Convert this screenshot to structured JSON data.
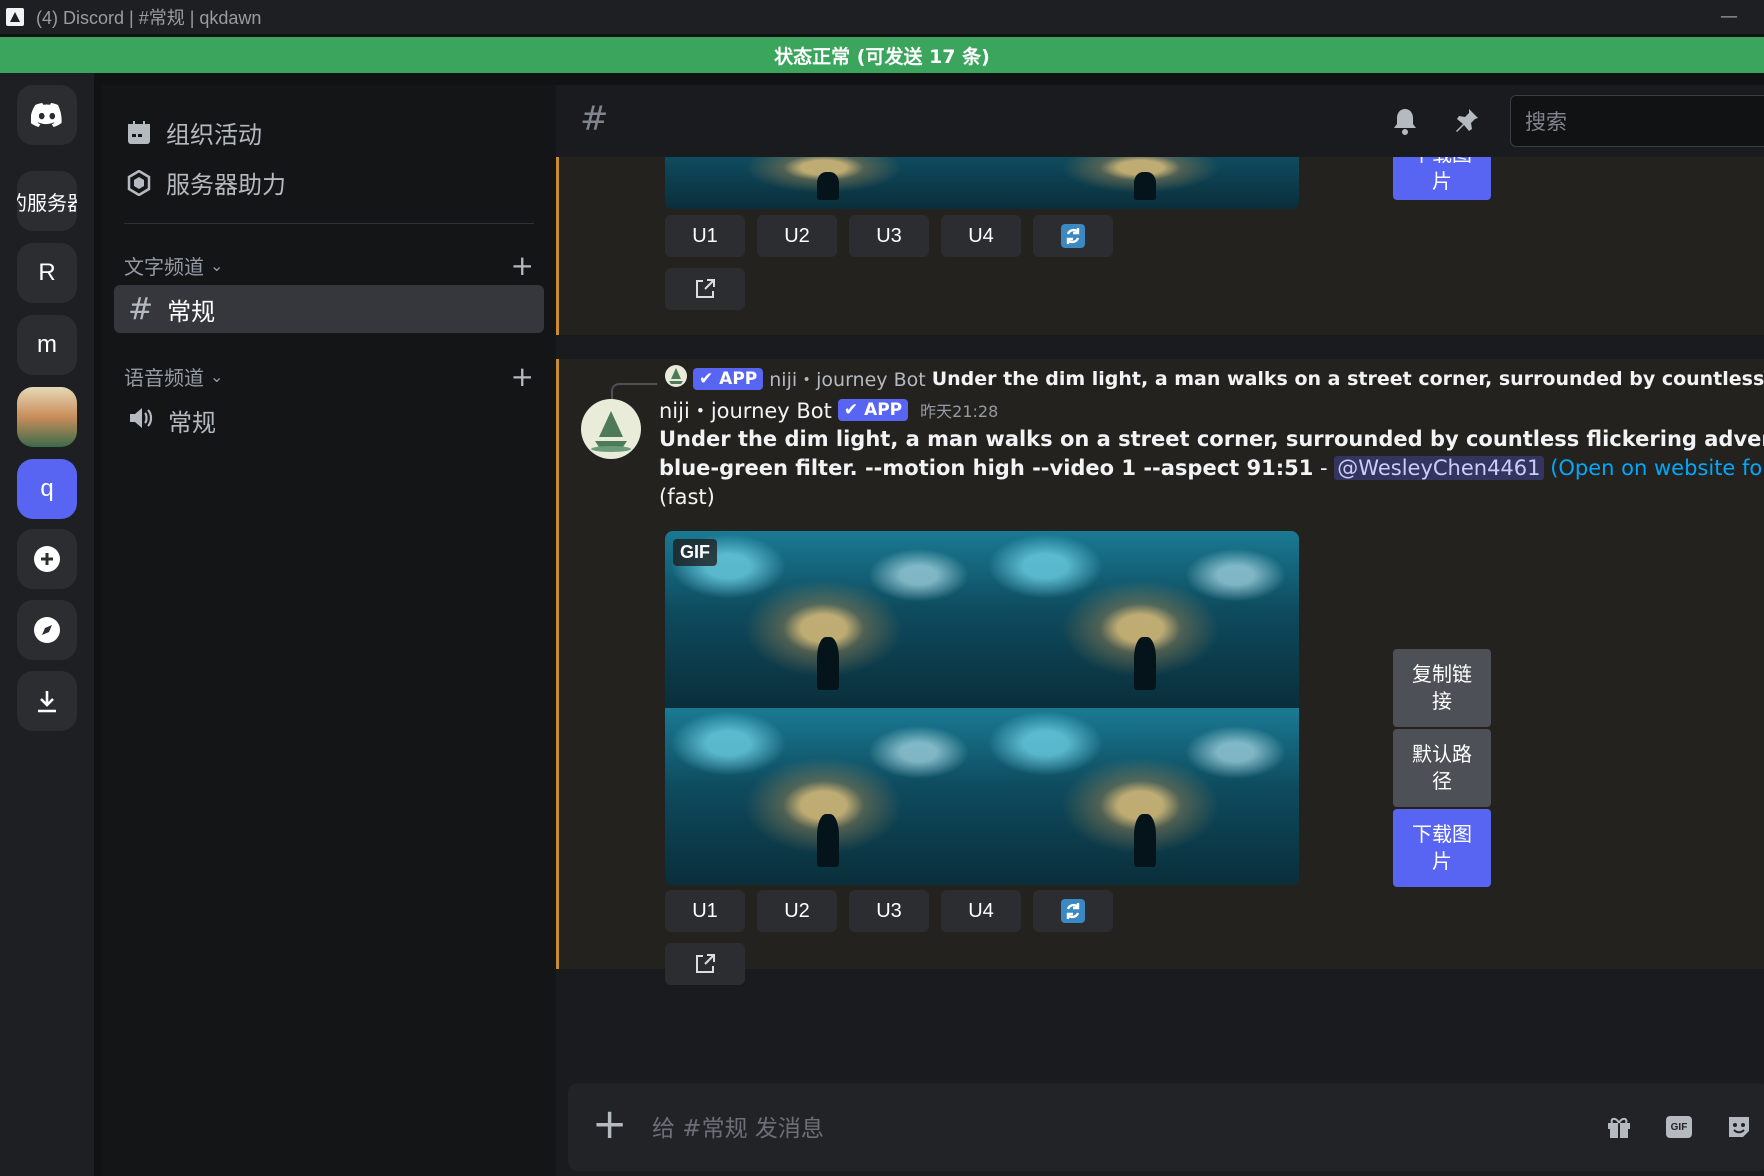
{
  "window": {
    "title": "(4) Discord | #常规 | qkdawn",
    "minimize_glyph": "—"
  },
  "status_bar": {
    "text": "状态正常 (可发送 17 条)",
    "color": "#3ba55d"
  },
  "servers": [
    {
      "label": "",
      "icon": "discord-logo-icon"
    },
    {
      "label": "的服务器"
    },
    {
      "label": "R"
    },
    {
      "label": "m"
    },
    {
      "label": "",
      "icon": "server-avatar-image"
    },
    {
      "label": "q"
    },
    {
      "label": "",
      "icon": "add-server-icon"
    },
    {
      "label": "",
      "icon": "explore-icon"
    },
    {
      "label": "",
      "icon": "download-icon"
    }
  ],
  "channel_sidebar": {
    "top_items": [
      {
        "label": "组织活动",
        "icon": "calendar-icon"
      },
      {
        "label": "服务器助力",
        "icon": "boost-icon"
      }
    ],
    "text_category": {
      "label": "文字频道",
      "chevron": "⌄",
      "add": "+"
    },
    "text_channels": [
      {
        "label": "常规",
        "active": true,
        "glyph": "#"
      }
    ],
    "voice_category": {
      "label": "语音频道",
      "chevron": "⌄",
      "add": "+"
    },
    "voice_channels": [
      {
        "label": "常规",
        "icon": "speaker-icon"
      }
    ]
  },
  "header": {
    "channel_glyph": "#",
    "search_placeholder": "搜索"
  },
  "messages": [
    {
      "upscale_buttons": [
        "U1",
        "U2",
        "U3",
        "U4"
      ],
      "refresh_glyph": "🔄",
      "side_buttons": [
        {
          "label": "下载图片",
          "color": "#5865f2"
        }
      ]
    },
    {
      "reply": {
        "app_badge": "✔ APP",
        "author": "niji・journey Bot",
        "text": "Under the dim light, a man walks on a street corner, surrounded by countless flickering adv"
      },
      "author": "niji・journey Bot",
      "app_badge": "✔ APP",
      "timestamp": "昨天21:28",
      "content_line1": "Under the dim light, a man walks on a street corner, surrounded by countless flickering advertisements w",
      "content_line2_prefix": "blue-green filter. --motion high --video 1 --aspect 91:51",
      "content_dash": " - ",
      "mention": "@WesleyChen4461",
      "link_text": " (Open on website for full qua",
      "content_line3": "(fast)",
      "gif_badge": "GIF",
      "upscale_buttons": [
        "U1",
        "U2",
        "U3",
        "U4"
      ],
      "refresh_glyph": "🔄",
      "side_buttons": [
        {
          "label": "复制链接",
          "color": "#4e5058"
        },
        {
          "label": "默认路径",
          "color": "#4e5058"
        },
        {
          "label": "下载图片",
          "color": "#5865f2"
        }
      ]
    }
  ],
  "composer": {
    "add_glyph": "+",
    "placeholder": "给 #常规 发消息",
    "icons": [
      "gift-icon",
      "gif-icon",
      "sticker-icon"
    ],
    "gif_label": "GIF"
  }
}
